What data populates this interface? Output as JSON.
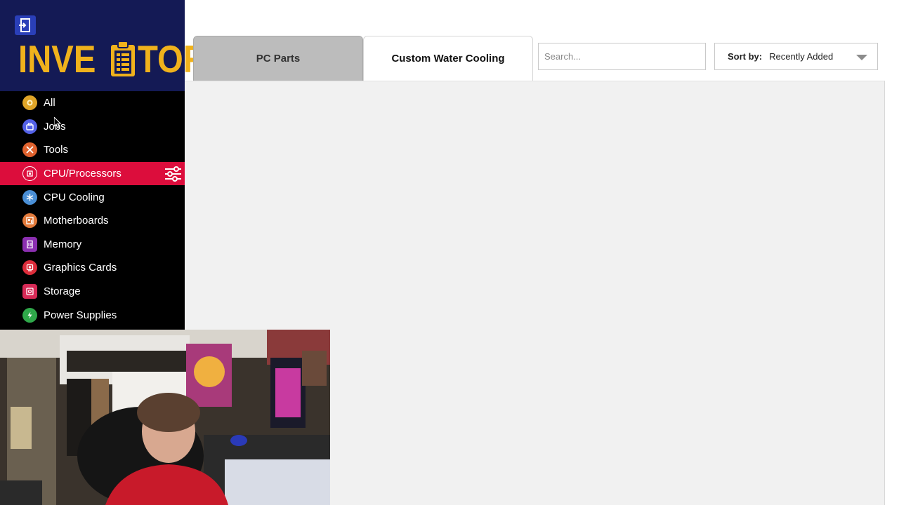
{
  "brand": {
    "logo_text_left": "INVE",
    "logo_text_right": "TORY"
  },
  "nav": {
    "items": [
      {
        "label": "All",
        "icon": "circle-dot-icon",
        "color": "#e0a528"
      },
      {
        "label": "Jobs",
        "icon": "briefcase-icon",
        "color": "#5361e6"
      },
      {
        "label": "Tools",
        "icon": "tools-icon",
        "color": "#e0622e"
      },
      {
        "label": "CPU/Processors",
        "icon": "cpu-chip-icon",
        "color": "#dc0d3c",
        "active": true
      },
      {
        "label": "CPU Cooling",
        "icon": "snowflake-icon",
        "color": "#4a8fd6"
      },
      {
        "label": "Motherboards",
        "icon": "motherboard-icon",
        "color": "#e27a3b"
      },
      {
        "label": "Memory",
        "icon": "memory-stick-icon",
        "color": "#8b2fb0"
      },
      {
        "label": "Graphics Cards",
        "icon": "gpu-icon",
        "color": "#dd2d3b"
      },
      {
        "label": "Storage",
        "icon": "hard-drive-icon",
        "color": "#d62a56"
      },
      {
        "label": "Power Supplies",
        "icon": "lightning-icon",
        "color": "#2fa84a"
      }
    ]
  },
  "tabs": [
    {
      "label": "PC Parts",
      "active": false
    },
    {
      "label": "Custom Water Cooling",
      "active": true
    }
  ],
  "search": {
    "placeholder": "Search..."
  },
  "sort": {
    "label": "Sort by:",
    "value": "Recently Added"
  },
  "colors": {
    "brand_bg": "#141a55",
    "logo_gold": "#f0b21c",
    "active_red": "#dc0d3c",
    "sidebar_bg": "#000000"
  }
}
